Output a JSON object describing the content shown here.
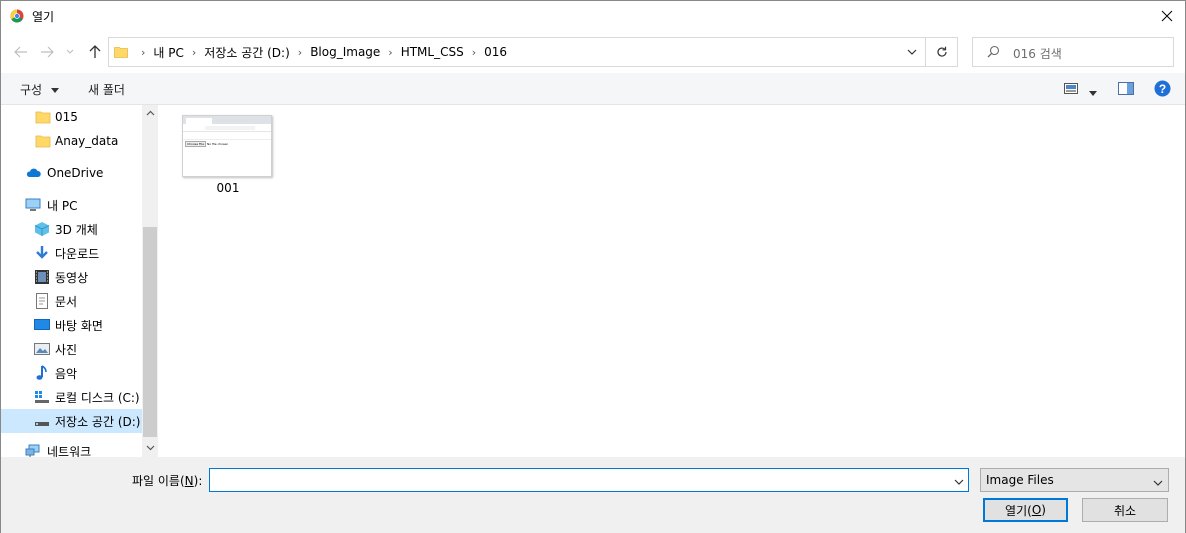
{
  "window": {
    "title": "열기"
  },
  "address": {
    "crumbs": [
      "내 PC",
      "저장소 공간 (D:)",
      "Blog_Image",
      "HTML_CSS",
      "016"
    ]
  },
  "search": {
    "placeholder": "016 검색"
  },
  "toolbar": {
    "organize_label": "구성",
    "new_folder_label": "새 폴더"
  },
  "nav": {
    "items": [
      {
        "label": "015",
        "icon": "folder-icon"
      },
      {
        "label": "Anay_data",
        "icon": "folder-icon"
      },
      {
        "label": "OneDrive",
        "icon": "cloud-icon"
      },
      {
        "label": "내 PC",
        "icon": "pc-icon"
      },
      {
        "label": "3D 개체",
        "icon": "cube-icon"
      },
      {
        "label": "다운로드",
        "icon": "download-icon"
      },
      {
        "label": "동영상",
        "icon": "video-icon"
      },
      {
        "label": "문서",
        "icon": "document-icon"
      },
      {
        "label": "바탕 화면",
        "icon": "desktop-icon"
      },
      {
        "label": "사진",
        "icon": "pictures-icon"
      },
      {
        "label": "음악",
        "icon": "music-icon"
      },
      {
        "label": "로컬 디스크 (C:)",
        "icon": "drive-icon"
      },
      {
        "label": "저장소 공간 (D:)",
        "icon": "drive-icon",
        "selected": true
      },
      {
        "label": "네트워크",
        "icon": "network-icon"
      }
    ]
  },
  "files": [
    {
      "name": "001",
      "thumb_button": "Choose File",
      "thumb_text": "No file chosen"
    }
  ],
  "footer": {
    "filename_label": "파일 이름(",
    "filename_mnemonic": "N",
    "filename_label_end": "):",
    "filename_value": "",
    "filetype_value": "Image Files",
    "open_label": "열기(",
    "open_mnemonic": "O",
    "open_label_end": ")",
    "cancel_label": "취소"
  },
  "colors": {
    "accent": "#0078d7",
    "selected": "#cce8ff",
    "folder": "#ffd867",
    "help": "#1e6fd6"
  }
}
